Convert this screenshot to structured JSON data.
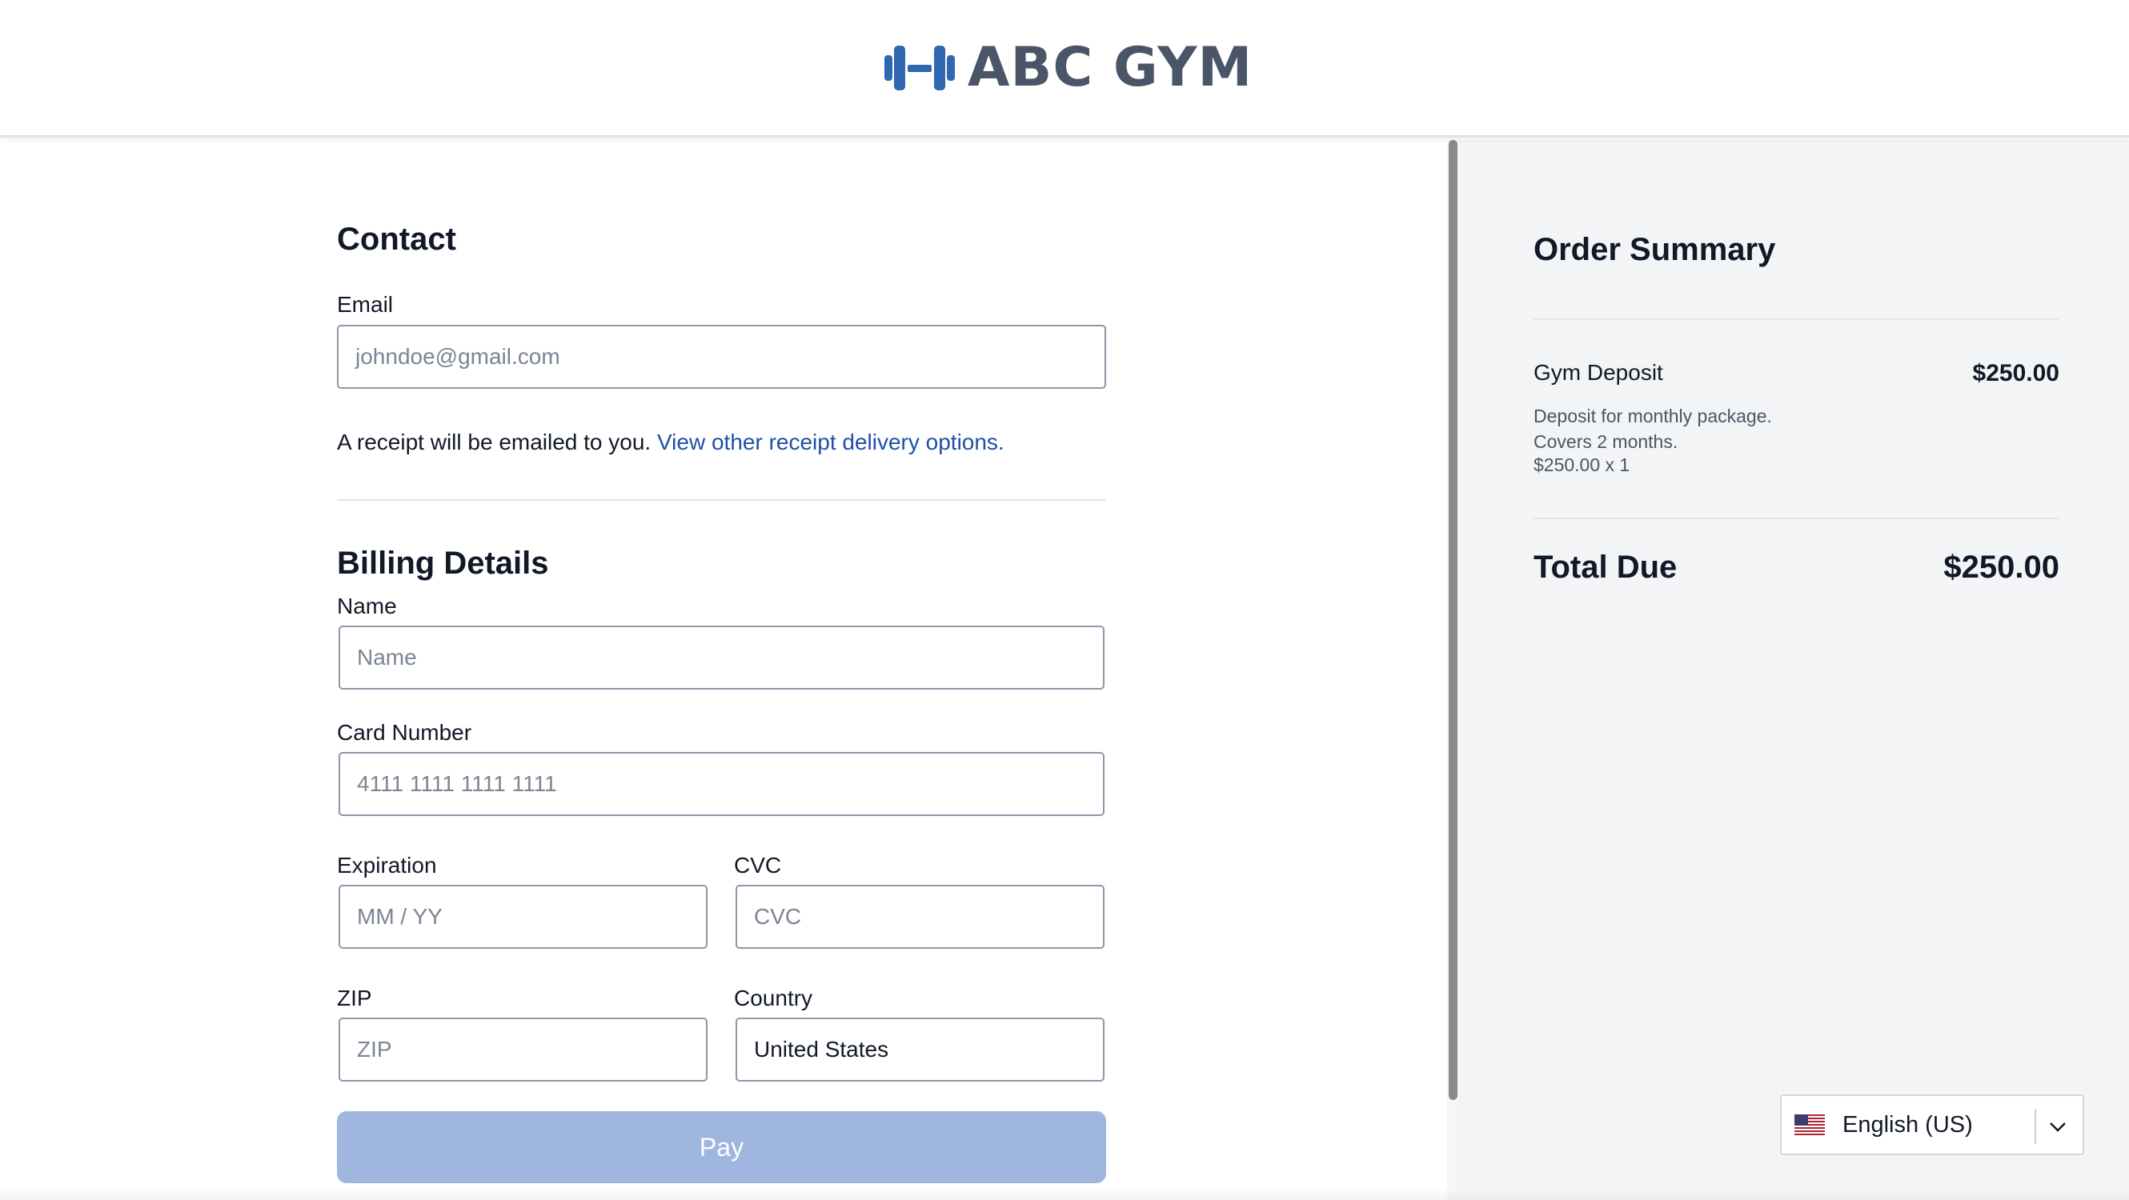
{
  "header": {
    "brand_name": "ABC GYM",
    "logo_icon": "dumbbell-icon",
    "brand_color": "#2f67b1"
  },
  "contact": {
    "title": "Contact",
    "email_label": "Email",
    "email_placeholder": "johndoe@gmail.com",
    "receipt_text": "A receipt will be emailed to you.",
    "receipt_link": "View other receipt delivery options."
  },
  "billing": {
    "title": "Billing Details",
    "name_label": "Name",
    "name_placeholder": "Name",
    "card_label": "Card Number",
    "card_placeholder": "4111 1111 1111 1111",
    "expiration_label": "Expiration",
    "expiration_placeholder": "MM / YY",
    "cvc_label": "CVC",
    "cvc_placeholder": "CVC",
    "zip_label": "ZIP",
    "zip_placeholder": "ZIP",
    "country_label": "Country",
    "country_value": "United States",
    "pay_label": "Pay"
  },
  "summary": {
    "title": "Order Summary",
    "item_name": "Gym Deposit",
    "item_price": "$250.00",
    "item_description": "Deposit for monthly package. Covers 2 months.",
    "item_quantity": "$250.00 x 1",
    "total_label": "Total Due",
    "total_value": "$250.00"
  },
  "language": {
    "flag_icon": "us-flag-icon",
    "label": "English (US)",
    "chevron_icon": "chevron-down-icon"
  },
  "colors": {
    "link": "#1f4fa6",
    "pay_button_disabled": "#9fb6df",
    "summary_background": "#f3f4f6"
  }
}
